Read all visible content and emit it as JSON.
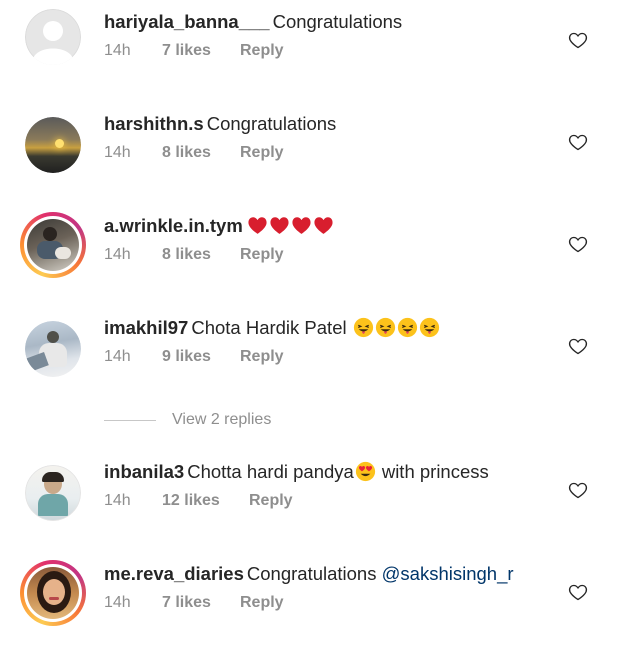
{
  "colors": {
    "text": "#262626",
    "meta": "#8e8e8e",
    "heart_emoji": "#d81e2e",
    "mention": "#003569"
  },
  "comments": [
    {
      "username": "hariyala_banna___",
      "text": "Congratulations",
      "time": "14h",
      "likes": "7 likes",
      "reply": "Reply",
      "avatar": "default-avatar"
    },
    {
      "username": "harshithn.s",
      "text": "Congratulations",
      "time": "14h",
      "likes": "8 likes",
      "reply": "Reply",
      "avatar": "sunset-photo"
    },
    {
      "username": "a.wrinkle.in.tym",
      "text": "",
      "emojis": [
        "red-heart",
        "red-heart",
        "red-heart",
        "red-heart"
      ],
      "time": "14h",
      "likes": "8 likes",
      "reply": "Reply",
      "avatar": "person-with-dog-photo",
      "story_ring": true
    },
    {
      "username": "imakhil97",
      "text": "Chota Hardik Patel",
      "emojis": [
        "tongue-out-emoji",
        "tongue-out-emoji",
        "tongue-out-emoji",
        "tongue-out-emoji"
      ],
      "time": "14h",
      "likes": "9 likes",
      "reply": "Reply",
      "avatar": "person-outdoors-photo"
    },
    {
      "username": "inbanila3",
      "text": "Chotta hardi pandya",
      "emoji_inline": "heart-eyes-emoji",
      "text_after": "with princess",
      "time": "14h",
      "likes": "12 likes",
      "reply": "Reply",
      "avatar": "person-photo"
    },
    {
      "username": "me.reva_diaries",
      "text": "Congratulations",
      "mention": "@sakshisingh_r",
      "time": "14h",
      "likes": "7 likes",
      "reply": "Reply",
      "avatar": "woman-portrait-photo",
      "story_ring": true
    }
  ],
  "view_replies": {
    "label": "View 2 replies"
  }
}
